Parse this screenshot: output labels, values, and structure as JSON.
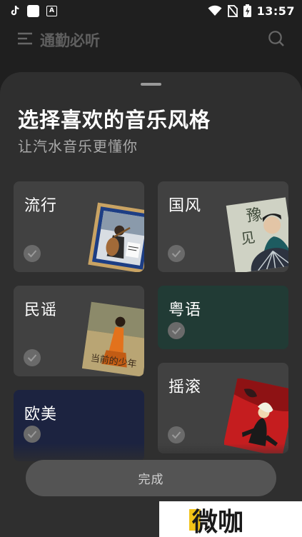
{
  "status_bar": {
    "time": "13:57"
  },
  "header": {
    "title": "通勤必听"
  },
  "sheet": {
    "title": "选择喜欢的音乐风格",
    "subtitle": "让汽水音乐更懂你",
    "done_label": "完成"
  },
  "genres": [
    {
      "label": "流行",
      "selected": false
    },
    {
      "label": "国风",
      "selected": false
    },
    {
      "label": "民谣",
      "selected": false
    },
    {
      "label": "粤语",
      "selected": false
    },
    {
      "label": "欧美",
      "selected": false
    },
    {
      "label": "摇滚",
      "selected": false
    }
  ],
  "watermark": {
    "text": "微咖"
  },
  "colors": {
    "sheet_bg": "#2f2f2f",
    "card_bg": "#414141",
    "cantonese_bg": "#213b35",
    "western_bg": "#1c2340"
  }
}
